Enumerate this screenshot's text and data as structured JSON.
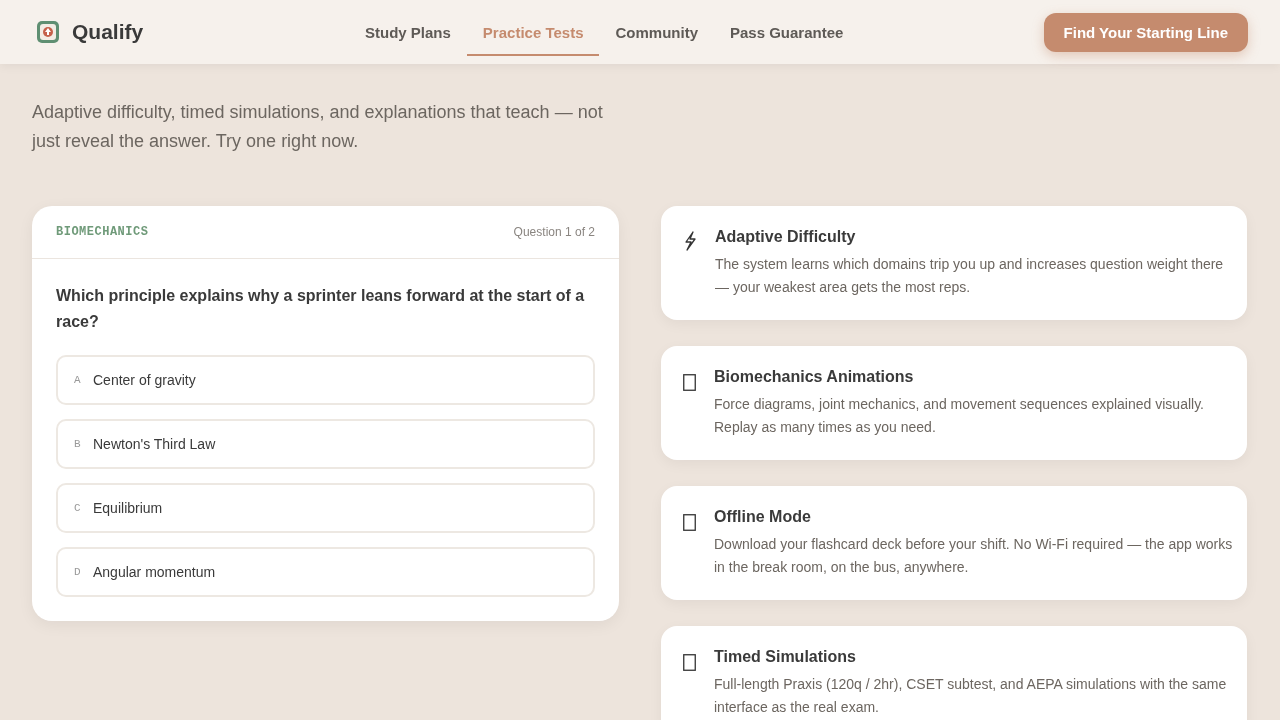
{
  "nav": {
    "brand": "Qualify",
    "links": [
      {
        "label": "Study Plans",
        "selected": false
      },
      {
        "label": "Practice Tests",
        "selected": true
      },
      {
        "label": "Community",
        "selected": false
      },
      {
        "label": "Pass Guarantee",
        "selected": false
      }
    ],
    "cta": "Find Your Starting Line"
  },
  "hero": {
    "subtitle": "Adaptive difficulty, timed simulations, and explanations that teach — not just reveal the answer. Try one right now."
  },
  "quiz": {
    "topic": "BIOMECHANICS",
    "progress": "Question 1 of 2",
    "question": "Which principle explains why a sprinter leans forward at the start of a race?",
    "options": [
      {
        "letter": "A",
        "text": "Center of gravity"
      },
      {
        "letter": "B",
        "text": "Newton's Third Law"
      },
      {
        "letter": "C",
        "text": "Equilibrium"
      },
      {
        "letter": "D",
        "text": "Angular momentum"
      }
    ]
  },
  "features": [
    {
      "kind": "bolt",
      "title": "Adaptive Difficulty",
      "text": "The system learns which domains trip you up and increases question weight there — your weakest area gets the most reps."
    },
    {
      "kind": "box",
      "title": "Biomechanics Animations",
      "text": "Force diagrams, joint mechanics, and movement sequences explained visually. Replay as many times as you need."
    },
    {
      "kind": "box",
      "title": "Offline Mode",
      "text": "Download your flashcard deck before your shift. No Wi-Fi required — the app works in the break room, on the bus, anywhere."
    },
    {
      "kind": "box",
      "title": "Timed Simulations",
      "text": "Full-length Praxis (120q / 2hr), CSET subtest, and AEPA simulations with the same interface as the real exam."
    }
  ]
}
